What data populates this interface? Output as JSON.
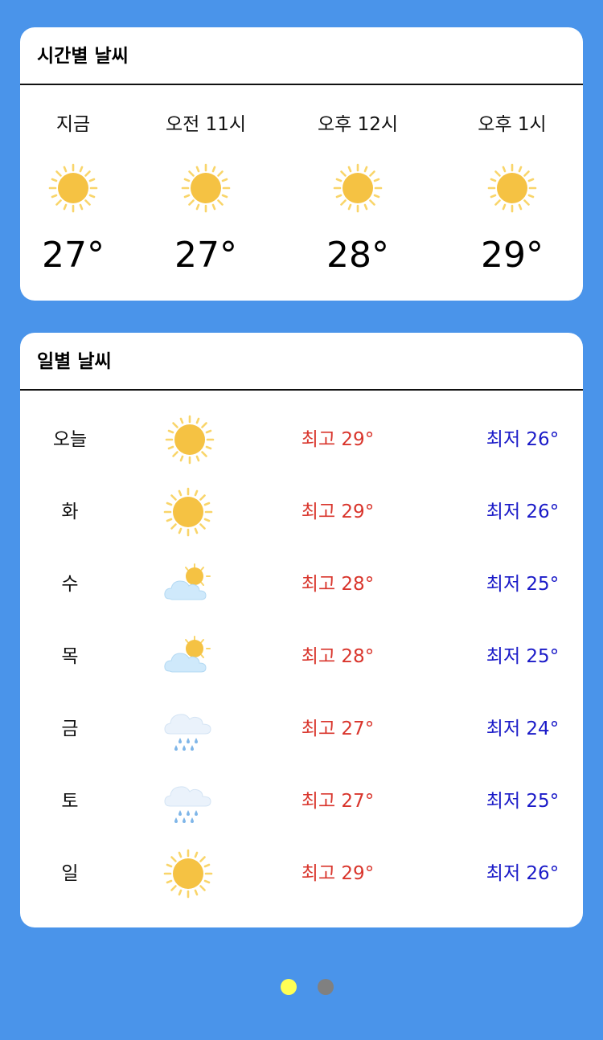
{
  "hourly": {
    "title": "시간별 날씨",
    "items": [
      {
        "time": "지금",
        "icon": "sun-icon",
        "temp": "27°"
      },
      {
        "time": "오전 11시",
        "icon": "sun-icon",
        "temp": "27°"
      },
      {
        "time": "오후 12시",
        "icon": "sun-icon",
        "temp": "28°"
      },
      {
        "time": "오후 1시",
        "icon": "sun-icon",
        "temp": "29°"
      }
    ]
  },
  "daily": {
    "title": "일별 날씨",
    "items": [
      {
        "day": "오늘",
        "icon": "sun-icon",
        "high": "최고 29°",
        "low": "최저 26°"
      },
      {
        "day": "화",
        "icon": "sun-icon",
        "high": "최고 29°",
        "low": "최저 26°"
      },
      {
        "day": "수",
        "icon": "partly-cloudy-icon",
        "high": "최고 28°",
        "low": "최저 25°"
      },
      {
        "day": "목",
        "icon": "partly-cloudy-icon",
        "high": "최고 28°",
        "low": "최저 25°"
      },
      {
        "day": "금",
        "icon": "rain-cloud-icon",
        "high": "최고 27°",
        "low": "최저 24°"
      },
      {
        "day": "토",
        "icon": "rain-cloud-icon",
        "high": "최고 27°",
        "low": "최저 25°"
      },
      {
        "day": "일",
        "icon": "sun-icon",
        "high": "최고 29°",
        "low": "최저 26°"
      }
    ]
  },
  "pager": {
    "pages": 2,
    "current": 1,
    "active_color": "#ffff55",
    "inactive_color": "#808080"
  },
  "colors": {
    "background": "#4a94ea",
    "high_temp": "#d9352c",
    "low_temp": "#1a1ac8",
    "sun": "#f5c243"
  }
}
